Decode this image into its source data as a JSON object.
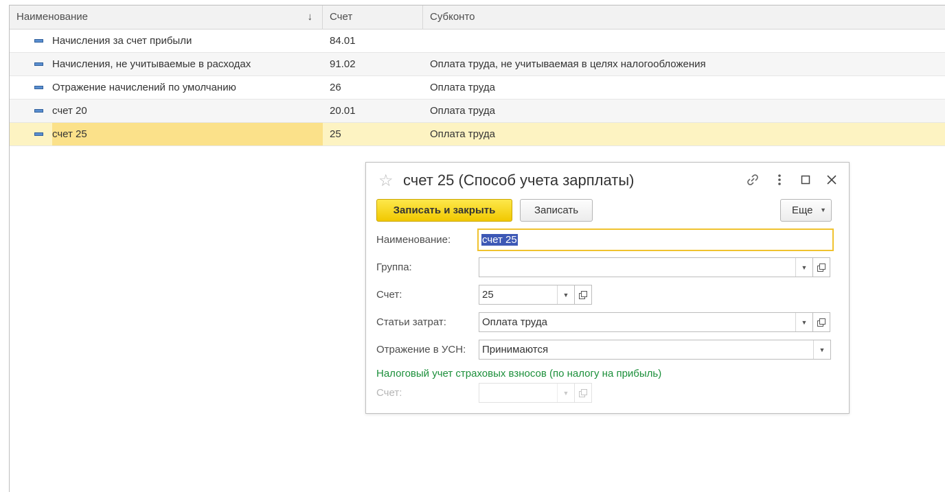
{
  "table": {
    "columns": [
      "Наименование",
      "Счет",
      "Субконто"
    ],
    "rows": [
      {
        "name": "Начисления за счет прибыли",
        "account": "84.01",
        "subconto": ""
      },
      {
        "name": "Начисления, не учитываемые в расходах",
        "account": "91.02",
        "subconto": "Оплата труда, не учитываемая в целях налогообложения"
      },
      {
        "name": "Отражение начислений по умолчанию",
        "account": "26",
        "subconto": "Оплата труда"
      },
      {
        "name": "счет 20",
        "account": "20.01",
        "subconto": "Оплата труда"
      },
      {
        "name": "счет 25",
        "account": "25",
        "subconto": "Оплата труда"
      }
    ],
    "selected_row": 4
  },
  "dialog": {
    "title": "счет 25 (Способ учета зарплаты)",
    "buttons": {
      "save_close": "Записать и закрыть",
      "save": "Записать",
      "more": "Еще"
    },
    "fields": {
      "name": {
        "label": "Наименование:",
        "value": "счет 25"
      },
      "group": {
        "label": "Группа:",
        "value": ""
      },
      "account": {
        "label": "Счет:",
        "value": "25"
      },
      "cost_item": {
        "label": "Статьи затрат:",
        "value": "Оплата труда"
      },
      "usn": {
        "label": "Отражение в УСН:",
        "value": "Принимаются"
      }
    },
    "section_title": "Налоговый учет страховых взносов (по налогу на прибыль)",
    "tax_account": {
      "label": "Счет:",
      "value": ""
    }
  },
  "icons": {
    "star": "star-icon",
    "link": "link-icon",
    "menu": "more-vert-icon",
    "maximize": "maximize-icon",
    "close": "close-icon"
  },
  "colors": {
    "primary_button": "#f5d20c",
    "selected_row": "#fdf3c2",
    "selected_cell": "#fbe18a",
    "section_title": "#1b8f3a",
    "focus_border": "#f0c22e",
    "text_selection": "#3d58b5"
  }
}
